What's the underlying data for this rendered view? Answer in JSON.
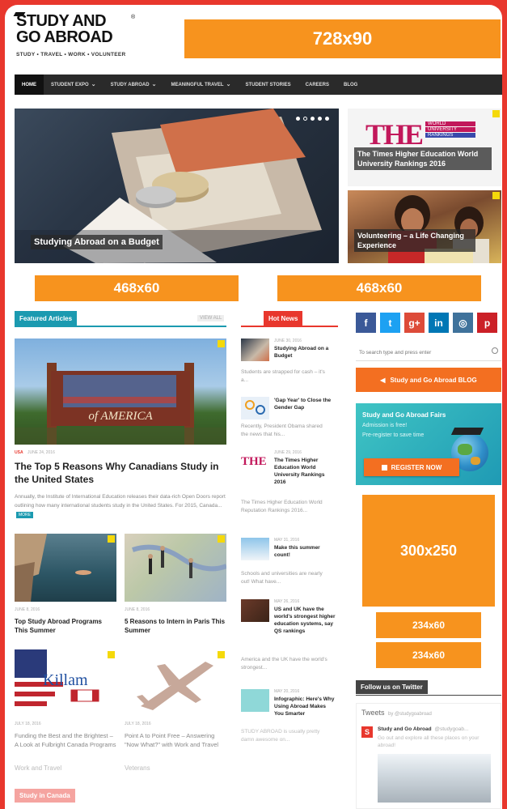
{
  "logo": {
    "title_line1": "STUDY AND",
    "title_line2": "GO ABROAD",
    "registered": "®",
    "tagline": "STUDY • TRAVEL • WORK • VOLUNTEER"
  },
  "ads": {
    "leaderboard": "728x90",
    "banner1": "468x60",
    "banner2": "468x60",
    "rect": "300x250",
    "small1": "234x60",
    "small2": "234x60"
  },
  "nav": [
    {
      "label": "HOME"
    },
    {
      "label": "STUDENT EXPO",
      "chevron": true
    },
    {
      "label": "STUDY ABROAD",
      "chevron": true
    },
    {
      "label": "MEANINGFUL TRAVEL",
      "chevron": true
    },
    {
      "label": "STUDENT STORIES"
    },
    {
      "label": "CAREERS"
    },
    {
      "label": "BLOG"
    }
  ],
  "slider": {
    "caption": "Studying Abroad on a Budget",
    "dots": 5
  },
  "side_feature1": {
    "logo_text": "THE",
    "logo_sub1": "WORLD",
    "logo_sub2": "UNIVERSITY",
    "logo_sub3": "RANKINGS",
    "caption": "The Times Higher Education World University Rankings 2016"
  },
  "side_feature2": {
    "caption": "Volunteering – a Life Changing Experience"
  },
  "featured": {
    "tab": "Featured Articles",
    "view_all": "VIEW ALL",
    "main": {
      "sign": "of AMERICA",
      "category": "USA",
      "date": "JUNE 24, 2016",
      "title": "The Top 5 Reasons Why Canadians Study in the United States",
      "excerpt": "Annually, the Institute of International Education releases their data-rich Open Doors report outlining how many international students study in the United States. For 2015, Canada...",
      "more": "MORE"
    },
    "grid": [
      {
        "date": "JUNE 8, 2016",
        "title": "Top Study Abroad Programs This Summer"
      },
      {
        "date": "JUNE 8, 2016",
        "title": "5 Reasons to Intern in Paris This Summer"
      },
      {
        "date": "JULY 18, 2016",
        "title": "Funding the Best and the Brightest – A Look at Fulbright Canada Programs",
        "category": "Work and Travel",
        "brand": "Killam"
      },
      {
        "date": "JULY 18, 2016",
        "title": "Point A to Point Free – Answering \"Now What?\" with Work and Travel",
        "category": "Veterans"
      }
    ],
    "bottom_tag": "Study in Canada"
  },
  "hot_news": {
    "tab": "Hot News",
    "items": [
      {
        "date": "JUNE 30, 2016",
        "title": "Studying Abroad on a Budget",
        "excerpt": "Students are strapped for cash – it's a..."
      },
      {
        "date": "JUNE 30, 2016",
        "title": "'Gap Year' to Close the Gender Gap",
        "excerpt": "Recently, President Obama shared the news that his..."
      },
      {
        "date": "JUNE 29, 2016",
        "title": "The Times Higher Education World University Rankings 2016",
        "excerpt": "The Times Higher Education World Reputation Rankings 2016..."
      },
      {
        "date": "MAY 31, 2016",
        "title": "Make this summer count!",
        "excerpt": "Schools and universities are nearly out! What have..."
      },
      {
        "date": "MAY 26, 2016",
        "title": "US and UK have the world's strongest higher education systems, say QS rankings",
        "excerpt": "America and the UK have the world's strongest..."
      },
      {
        "date": "MAY 20, 2016",
        "title": "Infographic: Here's Why Using Abroad Makes You Smarter",
        "excerpt": "STUDY ABROAD is usually pretty damn awesome on..."
      }
    ]
  },
  "sidebar": {
    "social": [
      {
        "name": "facebook",
        "glyph": "f",
        "color": "#3b5998"
      },
      {
        "name": "twitter",
        "glyph": "t",
        "color": "#1da1f2"
      },
      {
        "name": "google-plus",
        "glyph": "g+",
        "color": "#dd4b39"
      },
      {
        "name": "linkedin",
        "glyph": "in",
        "color": "#0077b5"
      },
      {
        "name": "instagram",
        "glyph": "◎",
        "color": "#3f729b"
      },
      {
        "name": "pinterest",
        "glyph": "p",
        "color": "#cb2027"
      }
    ],
    "search_placeholder": "To search type and press enter",
    "blog_button": "Study and Go Abroad BLOG",
    "fairs": {
      "title": "Study and Go Abroad Fairs",
      "line1": "Admission is free!",
      "line2": "Pre-register to save time",
      "button": "REGISTER NOW"
    },
    "twitter": {
      "heading": "Follow us on Twitter",
      "tweets_label": "Tweets",
      "by": "by @studygoabroad",
      "account": "Study and Go Abroad",
      "handle": "@studygoab...",
      "text": "Go out and explore all these places on your abroad!"
    }
  },
  "colors": {
    "orange": "#f7931e",
    "frame_red": "#e8372d",
    "nav": "#2a2a2a",
    "teal": "#1b9ab0",
    "hot": "#e8372d"
  }
}
